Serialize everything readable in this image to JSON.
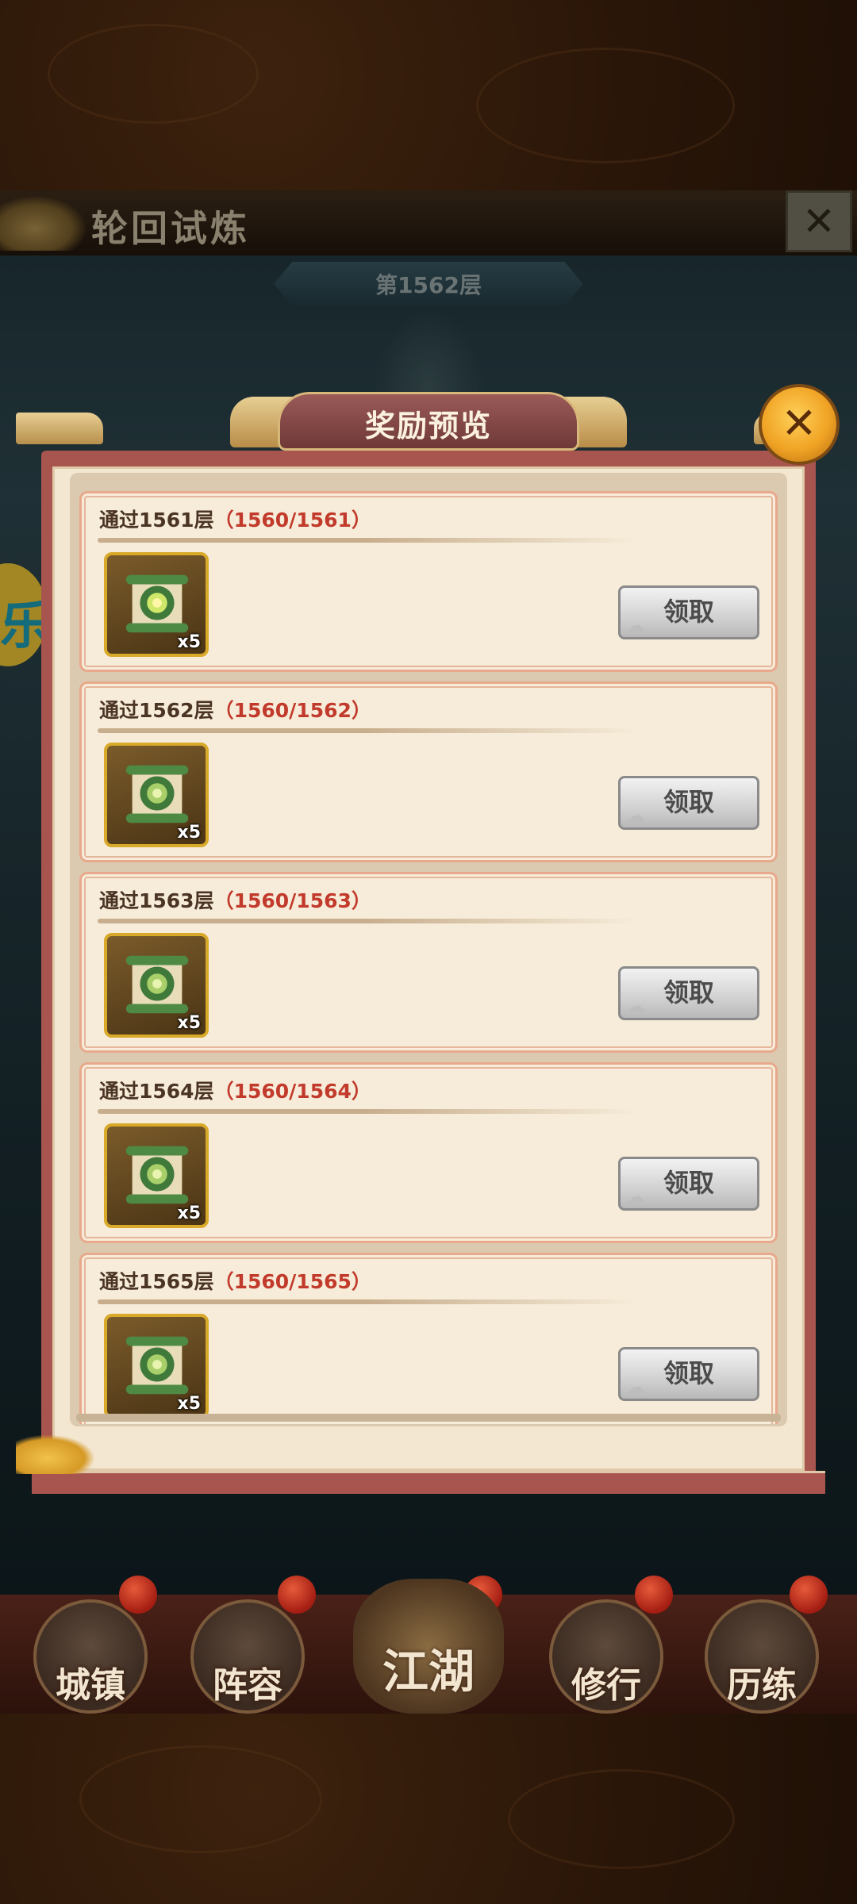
{
  "scene": {
    "title": "轮回试炼",
    "floor": "第1562层",
    "side_badge": "乐"
  },
  "dialog": {
    "title": "奖励预览",
    "rows": [
      {
        "label": "通过1561层",
        "progress": "（1560/1561）",
        "count": "x5",
        "button": "领取"
      },
      {
        "label": "通过1562层",
        "progress": "（1560/1562）",
        "count": "x5",
        "button": "领取"
      },
      {
        "label": "通过1563层",
        "progress": "（1560/1563）",
        "count": "x5",
        "button": "领取"
      },
      {
        "label": "通过1564层",
        "progress": "（1560/1564）",
        "count": "x5",
        "button": "领取"
      },
      {
        "label": "通过1565层",
        "progress": "（1560/1565）",
        "count": "x5",
        "button": "领取"
      }
    ]
  },
  "nav": {
    "items": [
      "城镇",
      "阵容",
      "江湖",
      "修行",
      "历练"
    ]
  },
  "colors": {
    "dialog_border": "#a8554f",
    "panel_bg": "#f3e7d2",
    "progress_red": "#c23a2b",
    "close_gold": "#f0a324"
  },
  "icons": {
    "reward": "jade-scroll-icon",
    "close": "close-x-icon",
    "nav_dot": "red-notification-dot"
  }
}
